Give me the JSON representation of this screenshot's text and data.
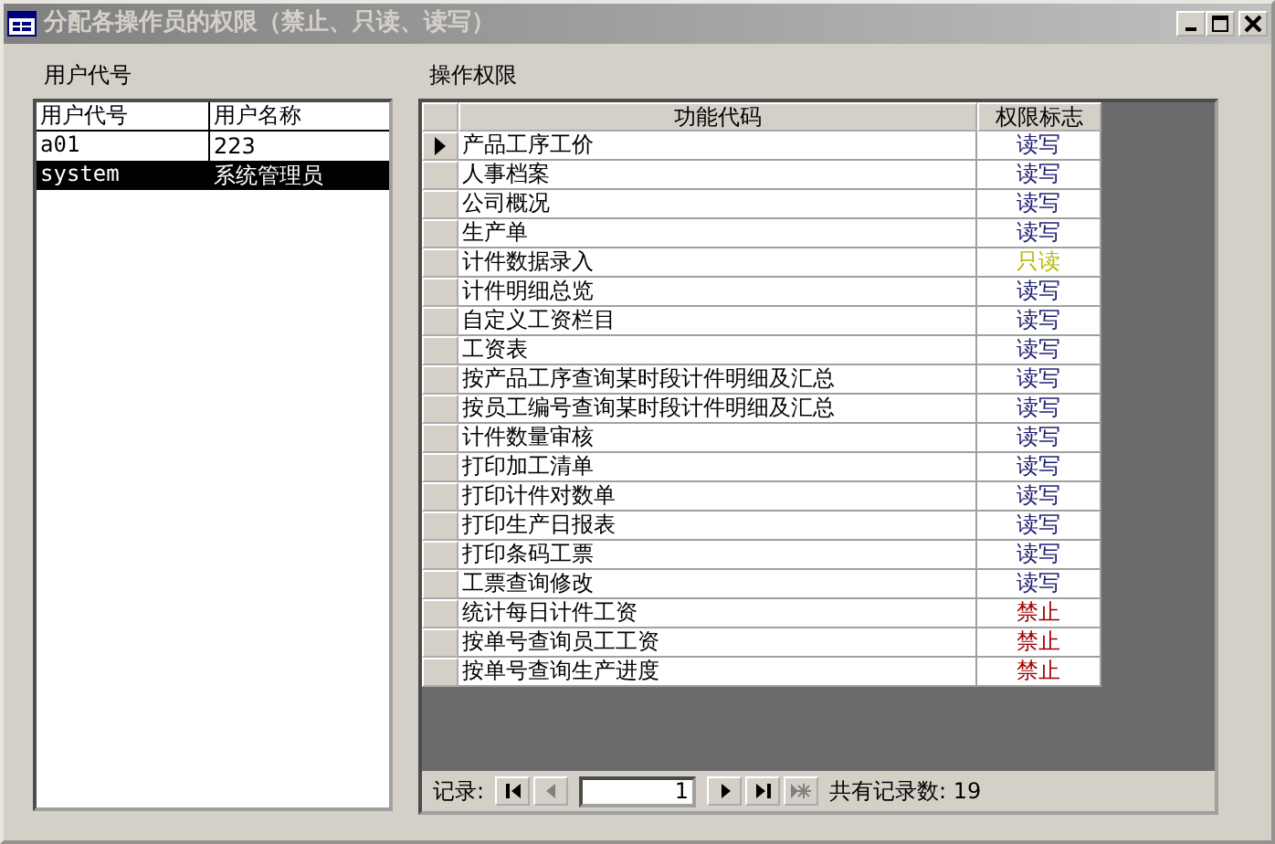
{
  "window": {
    "title": "分配各操作员的权限（禁止、只读、读写）",
    "controls": [
      {
        "kind": "minimize"
      },
      {
        "kind": "maximize"
      },
      {
        "kind": "close"
      }
    ]
  },
  "users": {
    "label": "用户代号",
    "columns": [
      "用户代号",
      "用户名称"
    ],
    "rows": [
      {
        "code": "a01",
        "name": "223",
        "selected": false
      },
      {
        "code": "system",
        "name": "系统管理员",
        "selected": true
      }
    ]
  },
  "permissions": {
    "label": "操作权限",
    "columns": [
      "功能代码",
      "权限标志"
    ],
    "rows": [
      {
        "function": "产品工序工价",
        "flag": "读写",
        "color": "#1c1c6e",
        "current": true
      },
      {
        "function": "人事档案",
        "flag": "读写",
        "color": "#1c1c6e",
        "current": false
      },
      {
        "function": "公司概况",
        "flag": "读写",
        "color": "#1c1c6e",
        "current": false
      },
      {
        "function": "生产单",
        "flag": "读写",
        "color": "#1c1c6e",
        "current": false
      },
      {
        "function": "计件数据录入",
        "flag": "只读",
        "color": "#b4bc00",
        "current": false
      },
      {
        "function": "计件明细总览",
        "flag": "读写",
        "color": "#1c1c6e",
        "current": false
      },
      {
        "function": "自定义工资栏目",
        "flag": "读写",
        "color": "#1c1c6e",
        "current": false
      },
      {
        "function": "工资表",
        "flag": "读写",
        "color": "#1c1c6e",
        "current": false
      },
      {
        "function": "按产品工序查询某时段计件明细及汇总",
        "flag": "读写",
        "color": "#1c1c6e",
        "current": false
      },
      {
        "function": "按员工编号查询某时段计件明细及汇总",
        "flag": "读写",
        "color": "#1c1c6e",
        "current": false
      },
      {
        "function": "计件数量审核",
        "flag": "读写",
        "color": "#1c1c6e",
        "current": false
      },
      {
        "function": "打印加工清单",
        "flag": "读写",
        "color": "#1c1c6e",
        "current": false
      },
      {
        "function": "打印计件对数单",
        "flag": "读写",
        "color": "#1c1c6e",
        "current": false
      },
      {
        "function": "打印生产日报表",
        "flag": "读写",
        "color": "#1c1c6e",
        "current": false
      },
      {
        "function": "打印条码工票",
        "flag": "读写",
        "color": "#1c1c6e",
        "current": false
      },
      {
        "function": "工票查询修改",
        "flag": "读写",
        "color": "#1c1c6e",
        "current": false
      },
      {
        "function": "统计每日计件工资",
        "flag": "禁止",
        "color": "#a00000",
        "current": false
      },
      {
        "function": "按单号查询员工工资",
        "flag": "禁止",
        "color": "#a00000",
        "current": false
      },
      {
        "function": "按单号查询生产进度",
        "flag": "禁止",
        "color": "#a00000",
        "current": false
      }
    ]
  },
  "navigator": {
    "label": "记录:",
    "record": "1",
    "total": "共有记录数: 19",
    "buttons": [
      {
        "kind": "first",
        "disabled": false
      },
      {
        "kind": "prev",
        "disabled": true
      },
      {
        "kind": "field"
      },
      {
        "kind": "next",
        "disabled": false
      },
      {
        "kind": "last",
        "disabled": false
      },
      {
        "kind": "new",
        "disabled": true
      }
    ]
  }
}
